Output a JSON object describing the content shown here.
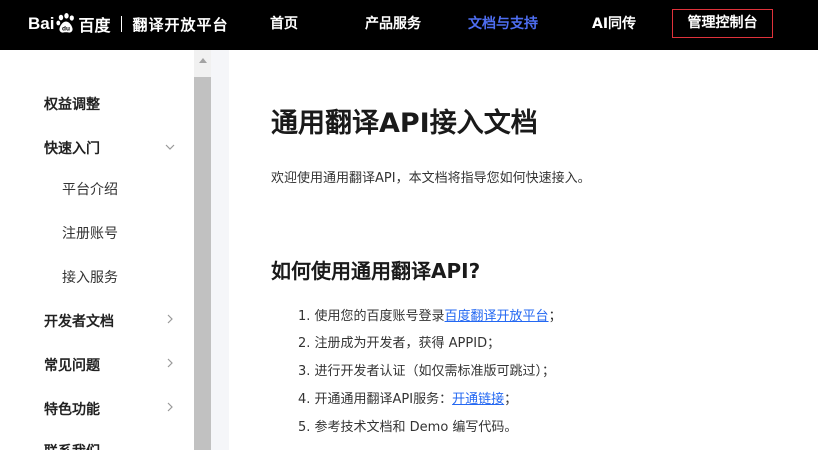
{
  "header": {
    "logo_bai": "Bai",
    "logo_du": "du",
    "logo_baidu_cn": "百度",
    "platform_title": "翻译开放平台",
    "nav": [
      {
        "label": "首页",
        "active": false
      },
      {
        "label": "产品服务",
        "active": false
      },
      {
        "label": "文档与支持",
        "active": true
      },
      {
        "label": "AI同传",
        "active": false
      }
    ],
    "console_label": "管理控制台",
    "active_color": "#4e6ef2",
    "console_border_color": "#e0323b"
  },
  "sidebar": {
    "items": [
      {
        "label": "权益调整",
        "level": 1,
        "chevron": "none"
      },
      {
        "label": "快速入门",
        "level": 1,
        "chevron": "chevron-down-icon"
      },
      {
        "label": "平台介绍",
        "level": 2,
        "chevron": "none"
      },
      {
        "label": "注册账号",
        "level": 2,
        "chevron": "none"
      },
      {
        "label": "接入服务",
        "level": 2,
        "chevron": "none"
      },
      {
        "label": "开发者文档",
        "level": 1,
        "chevron": "chevron-right-icon"
      },
      {
        "label": "常见问题",
        "level": 1,
        "chevron": "chevron-right-icon"
      },
      {
        "label": "特色功能",
        "level": 1,
        "chevron": "chevron-right-icon"
      },
      {
        "label": "联系我们",
        "level": 1,
        "chevron": "none"
      }
    ]
  },
  "main": {
    "title": "通用翻译API接入文档",
    "intro": "欢迎使用通用翻译API，本文档将指导您如何快速接入。",
    "section_title": "如何使用通用翻译API?",
    "steps": [
      {
        "prefix": "1. 使用您的百度账号登录",
        "link": "百度翻译开放平台",
        "suffix": "；"
      },
      {
        "text": "2. 注册成为开发者，获得 APPID；"
      },
      {
        "text": "3. 进行开发者认证（如仅需标准版可跳过）；"
      },
      {
        "prefix": "4. 开通通用翻译API服务：",
        "link": "开通链接",
        "suffix": "；"
      },
      {
        "text": "5. 参考技术文档和 Demo 编写代码。"
      }
    ],
    "link_color": "#2468f2"
  }
}
